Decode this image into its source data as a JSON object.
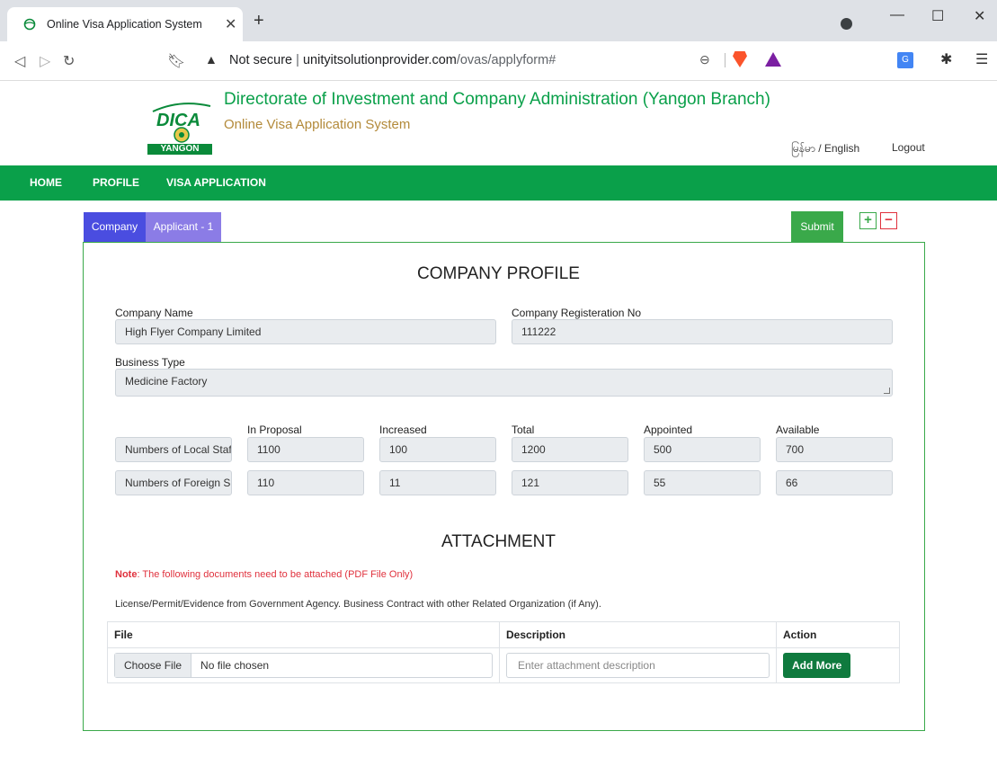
{
  "browser": {
    "tab_title": "Online Visa Application System",
    "url_warning": "Not secure",
    "url_host": "unityitsolutionprovider.com",
    "url_path": "/ovas/applyform#"
  },
  "header": {
    "logo_text": "DICA",
    "logo_sub": "YANGON",
    "title": "Directorate of Investment and Company Administration (Yangon Branch)",
    "subtitle": "Online Visa Application System",
    "language": "မြန်မာ / English",
    "logout": "Logout"
  },
  "nav": {
    "items": [
      "HOME",
      "PROFILE",
      "VISA APPLICATION"
    ]
  },
  "form_tabs": {
    "company": "Company",
    "applicant": "Applicant - 1",
    "submit": "Submit",
    "add": "+",
    "remove": "−"
  },
  "profile": {
    "heading": "COMPANY PROFILE",
    "company_name_label": "Company Name",
    "company_name": "High Flyer Company Limited",
    "reg_no_label": "Company Registeration No",
    "reg_no": "111222",
    "business_type_label": "Business Type",
    "business_type": "Medicine Factory",
    "columns": [
      "In Proposal",
      "Increased",
      "Total",
      "Appointed",
      "Available"
    ],
    "rows": [
      {
        "label": "Numbers of Local Staf",
        "values": [
          "1100",
          "100",
          "1200",
          "500",
          "700"
        ]
      },
      {
        "label": "Numbers of Foreign S",
        "values": [
          "110",
          "11",
          "121",
          "55",
          "66"
        ]
      }
    ]
  },
  "attachment": {
    "heading": "ATTACHMENT",
    "note_label": "Note",
    "note_text": ": The following documents need to be attached (PDF File Only)",
    "docs_text": "License/Permit/Evidence from Government Agency. Business Contract with other Related Organization (if Any).",
    "col_file": "File",
    "col_description": "Description",
    "col_action": "Action",
    "choose_file": "Choose File",
    "no_file": "No file chosen",
    "description_placeholder": "Enter attachment description",
    "add_more": "Add More"
  },
  "colors": {
    "brand_green": "#0aa04a",
    "tab_blue": "#4a4de0",
    "tab_purple": "#8b7ce6",
    "danger_red": "#e0313d"
  }
}
